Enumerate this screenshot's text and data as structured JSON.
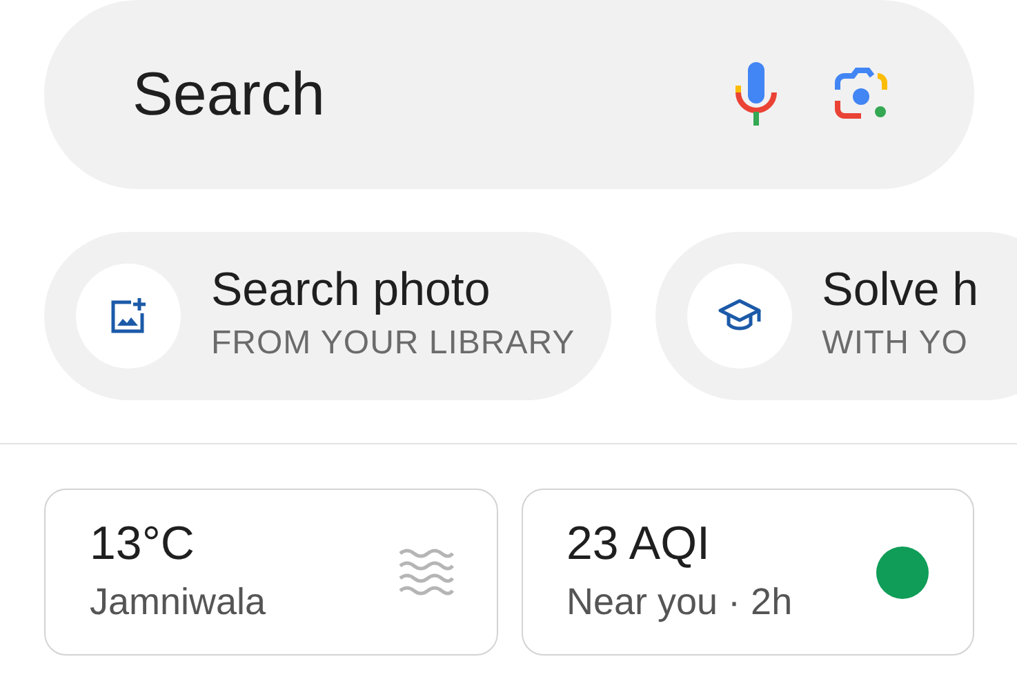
{
  "search": {
    "placeholder": "Search"
  },
  "chips": [
    {
      "title": "Search photo",
      "subtitle": "FROM YOUR LIBRARY",
      "kind": "photo"
    },
    {
      "title": "Solve h",
      "subtitle": "WITH YO",
      "kind": "homework"
    }
  ],
  "cards": [
    {
      "title": "13°C",
      "subtitle": "Jamniwala",
      "kind": "weather"
    },
    {
      "title": "23 AQI",
      "subtitle": "Near you · 2h",
      "kind": "aqi",
      "color": "#0f9d58"
    }
  ]
}
